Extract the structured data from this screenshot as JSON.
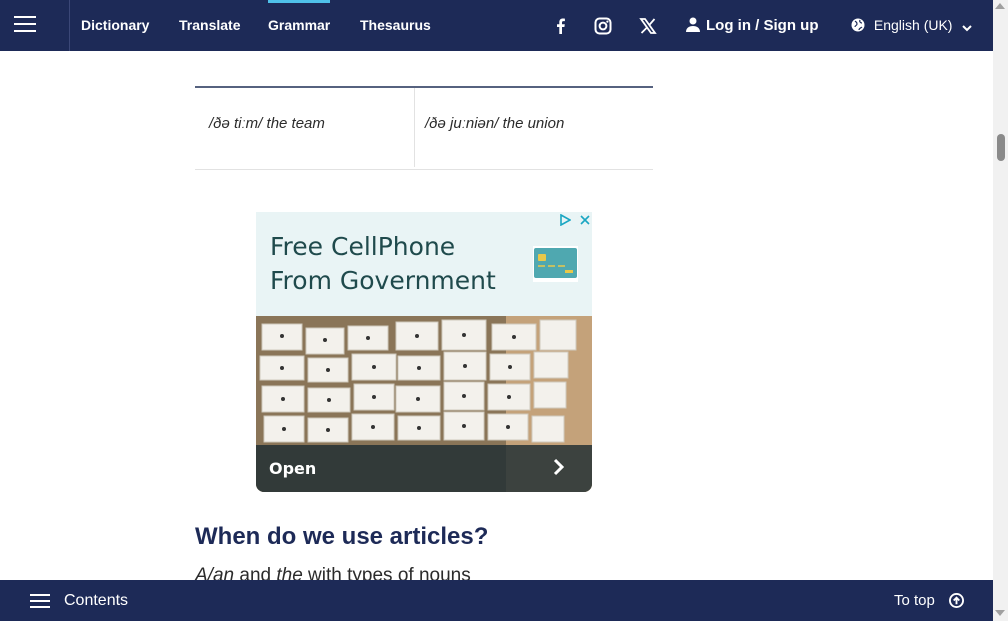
{
  "nav": {
    "links": [
      {
        "label": "Dictionary"
      },
      {
        "label": "Translate"
      },
      {
        "label": "Grammar",
        "active": true
      },
      {
        "label": "Thesaurus"
      }
    ],
    "social": [
      "facebook-icon",
      "instagram-icon",
      "x-icon"
    ],
    "login_label": "Log in / Sign up",
    "language": "English (UK)"
  },
  "pron_table": {
    "cells": [
      {
        "pron": "/ðə tiːm/",
        "word": "the team"
      },
      {
        "pron": "/ðə juːniən/",
        "word": "the union"
      }
    ]
  },
  "ad": {
    "headline_line1": "Free CellPhone",
    "headline_line2": "From Government",
    "cta": "Open"
  },
  "section": {
    "heading": "When do we use articles?",
    "subline_i1": "A/an",
    "subline_t1": " and ",
    "subline_i2": "the",
    "subline_t2": " with types of nouns"
  },
  "bottom": {
    "contents_label": "Contents",
    "totop_label": "To top"
  },
  "colors": {
    "navy": "#1d2a57",
    "active_accent": "#4fc1e9",
    "ad_teal": "#1f4a4c"
  }
}
